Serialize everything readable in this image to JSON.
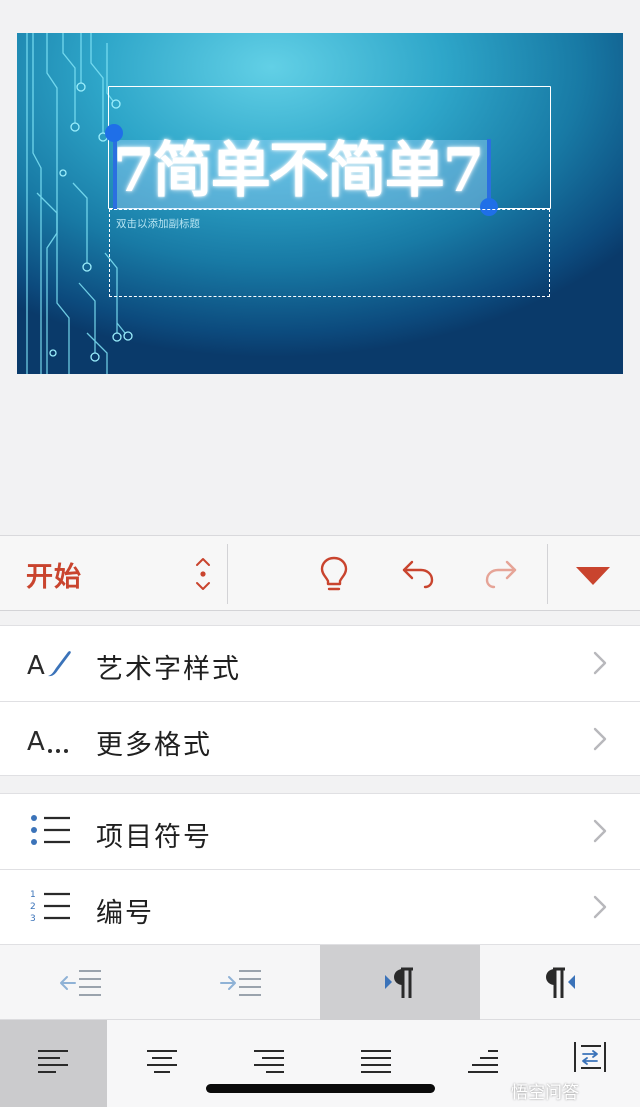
{
  "slide": {
    "title": "7简单不简单7",
    "subtitle_placeholder": "双击以添加副标题"
  },
  "toolbar": {
    "tab_label": "开始",
    "icons": [
      "tab-switch-icon",
      "lightbulb-icon",
      "undo-icon",
      "redo-icon",
      "collapse-triangle-icon"
    ],
    "accent_color": "#c9442e"
  },
  "menu": {
    "items": [
      {
        "label": "艺术字样式",
        "icon": "wordart-style-icon"
      },
      {
        "label": "更多格式",
        "icon": "more-formats-icon"
      },
      {
        "label": "项目符号",
        "icon": "bullets-icon"
      },
      {
        "label": "编号",
        "icon": "numbering-icon"
      }
    ]
  },
  "indent_row": {
    "buttons": [
      "decrease-indent-icon",
      "increase-indent-icon",
      "left-to-right-icon",
      "right-to-left-icon"
    ],
    "active": "left-to-right"
  },
  "align_row": {
    "buttons": [
      "align-left-icon",
      "align-center-icon",
      "align-right-icon",
      "justify-icon",
      "distributed-icon",
      "line-spacing-icon"
    ],
    "active": "align-left"
  },
  "watermark": "悟空问答"
}
